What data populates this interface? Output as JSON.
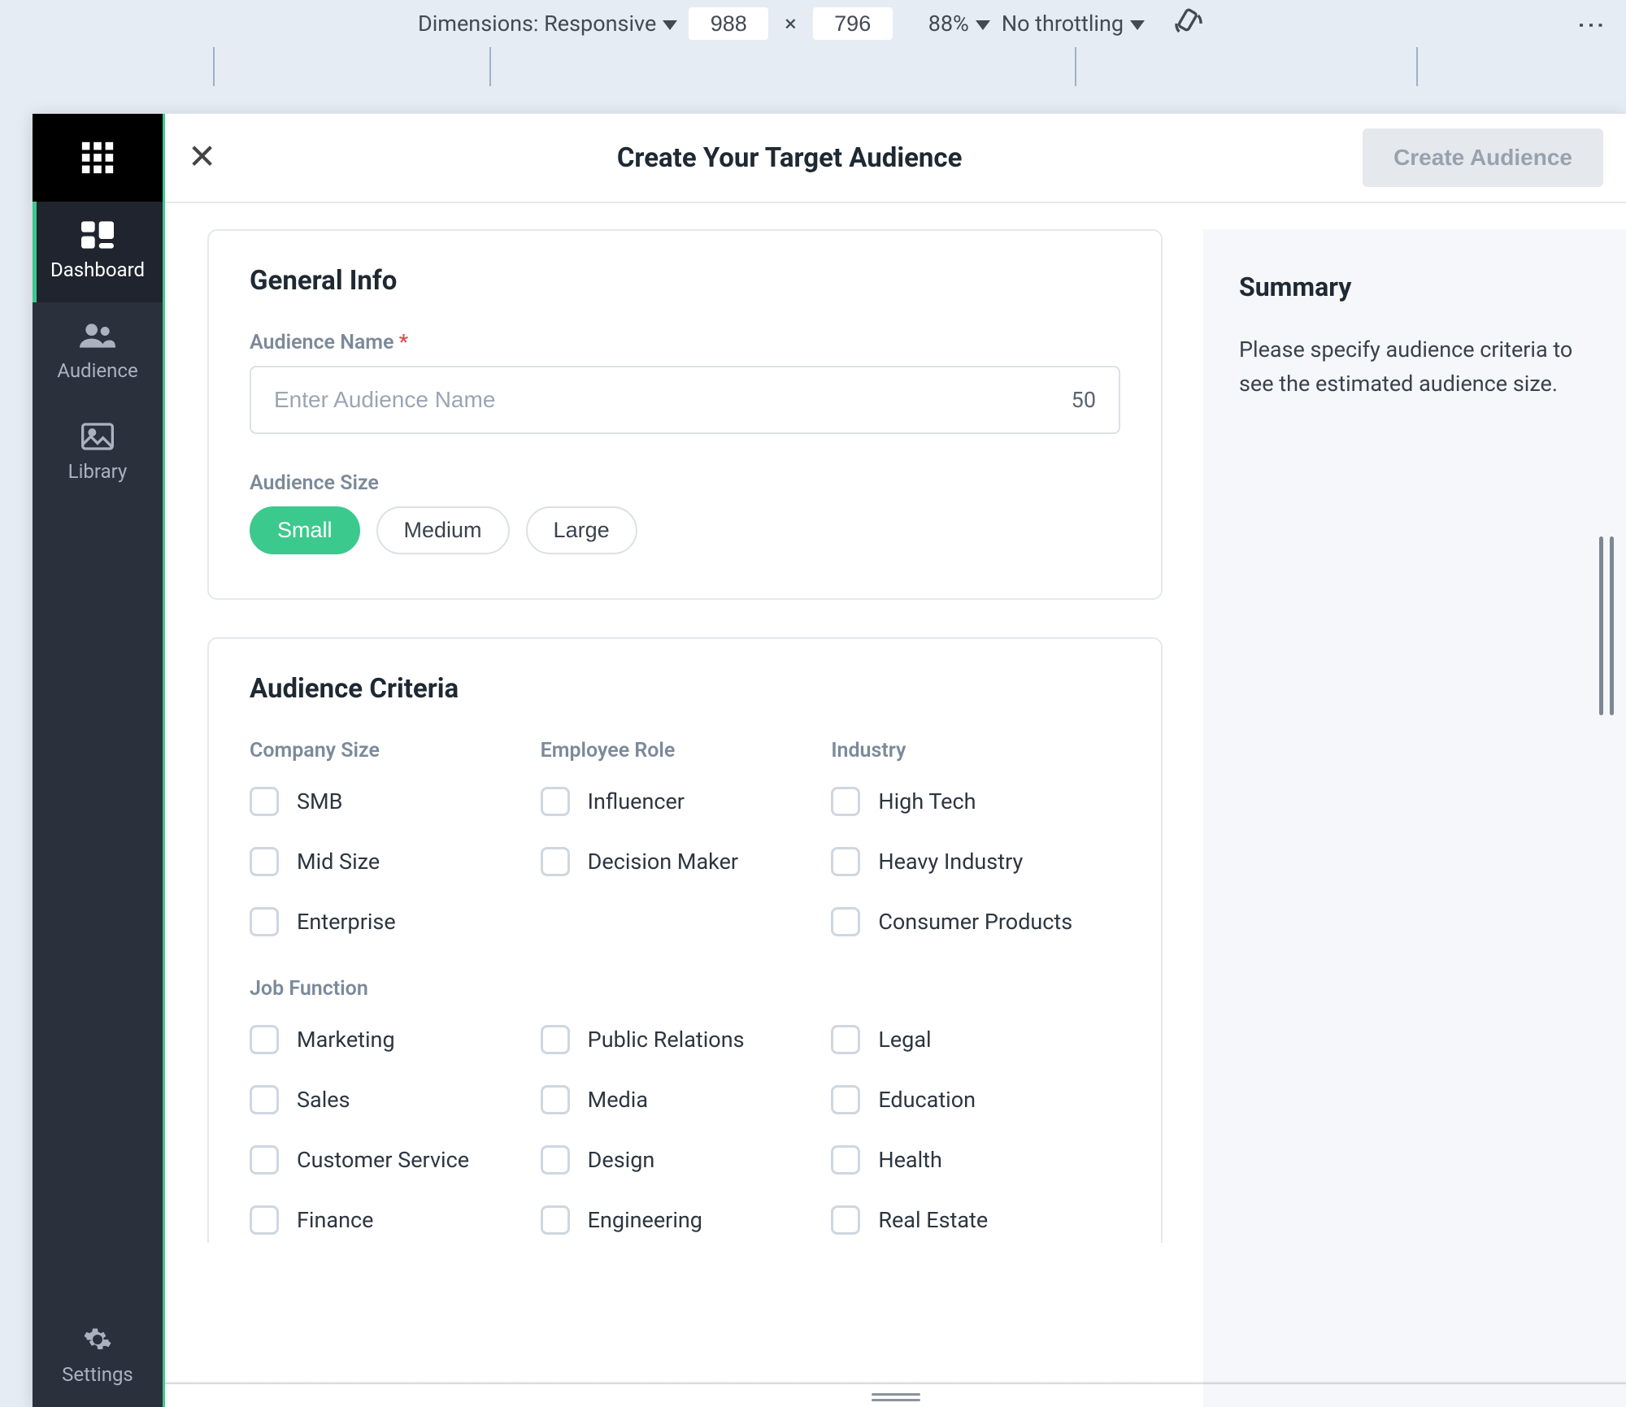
{
  "devbar": {
    "dimensions_label": "Dimensions: Responsive",
    "width": "988",
    "height": "796",
    "zoom": "88%",
    "throttling": "No throttling"
  },
  "sidebar": {
    "items": [
      {
        "id": "dashboard",
        "label": "Dashboard",
        "active": true
      },
      {
        "id": "audience",
        "label": "Audience",
        "active": false
      },
      {
        "id": "library",
        "label": "Library",
        "active": false
      }
    ],
    "settings_label": "Settings"
  },
  "topbar": {
    "title": "Create Your Target Audience",
    "create_label": "Create Audience"
  },
  "general": {
    "heading": "General Info",
    "name_label": "Audience Name",
    "name_placeholder": "Enter Audience Name",
    "name_counter": "50",
    "size_label": "Audience Size",
    "sizes": [
      "Small",
      "Medium",
      "Large"
    ],
    "size_selected": "Small"
  },
  "criteria": {
    "heading": "Audience Criteria",
    "company_size": {
      "label": "Company Size",
      "options": [
        "SMB",
        "Mid Size",
        "Enterprise"
      ]
    },
    "employee_role": {
      "label": "Employee Role",
      "options": [
        "Influencer",
        "Decision Maker"
      ]
    },
    "industry": {
      "label": "Industry",
      "options": [
        "High Tech",
        "Heavy Industry",
        "Consumer Products"
      ]
    },
    "job_function": {
      "label": "Job Function",
      "options": [
        "Marketing",
        "Public Relations",
        "Legal",
        "Sales",
        "Media",
        "Education",
        "Customer Service",
        "Design",
        "Health",
        "Finance",
        "Engineering",
        "Real Estate"
      ]
    }
  },
  "summary": {
    "heading": "Summary",
    "text": "Please specify audience criteria to see the estimated audience size."
  }
}
